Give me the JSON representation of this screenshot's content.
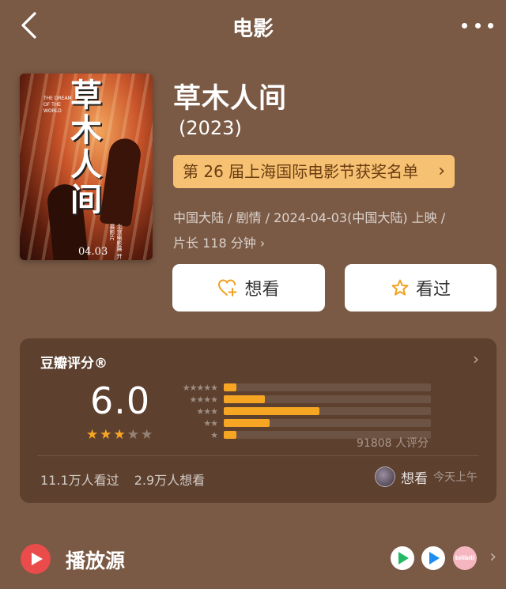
{
  "header": {
    "title": "电影"
  },
  "poster": {
    "title_art": "草木人间",
    "en_text": "THE DREAM OF THE WORLD",
    "side_text": "北京电影展 开幕影片",
    "date": "04.03"
  },
  "movie": {
    "title": "草木人间",
    "year": "(2023)",
    "award": "第 26 届上海国际电影节获奖名单",
    "meta_line1": "中国大陆 / 剧情 / 2024-04-03(中国大陆) 上映 /",
    "meta_line2": "片长 118 分钟",
    "want_label": "想看",
    "seen_label": "看过"
  },
  "rating": {
    "title": "豆瓣评分®",
    "score": "6.0",
    "stars_filled": 3,
    "stars_total": 5,
    "distribution": [
      {
        "stars": "★★★★★",
        "fraction": 0.06
      },
      {
        "stars": "★★★★",
        "fraction": 0.2
      },
      {
        "stars": "★★★",
        "fraction": 0.46
      },
      {
        "stars": "★★",
        "fraction": 0.22
      },
      {
        "stars": "★",
        "fraction": 0.06
      }
    ],
    "count": "91808 人评分",
    "seen_count": "11.1万人看过",
    "want_count": "2.9万人想看",
    "user_action": "想看",
    "user_time": "今天上午"
  },
  "play": {
    "label": "播放源",
    "source3": "bilibili"
  },
  "colors": {
    "background": "#7a5a45",
    "accent": "#f6a623",
    "award_bg": "#f6c172"
  },
  "icons": {
    "back": "chevron-left-icon",
    "more": "more-icon",
    "want": "heart-plus-icon",
    "seen": "star-outline-icon"
  }
}
